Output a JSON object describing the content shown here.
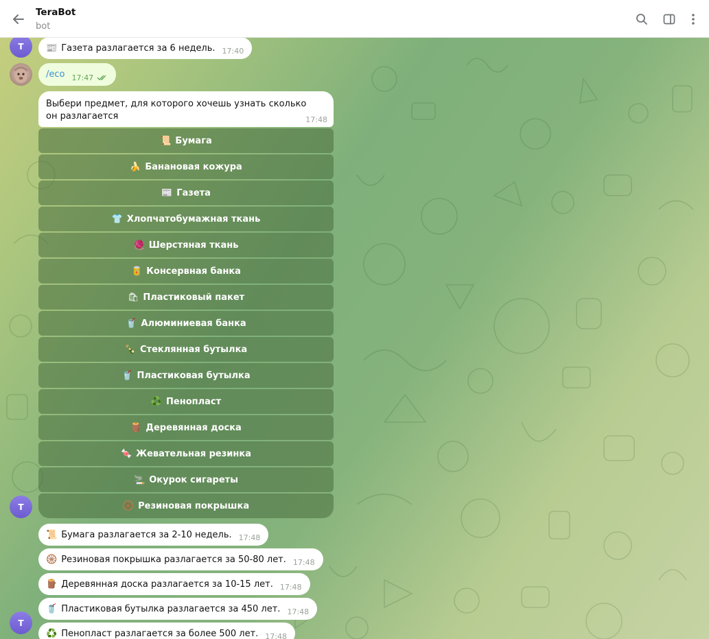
{
  "header": {
    "title": "TeraBot",
    "subtitle": "bot"
  },
  "avatars": {
    "bot_letter": "T"
  },
  "messages": {
    "newspaper": {
      "emoji": "📰",
      "text": "Газета разлагается за 6 недель.",
      "time": "17:40"
    },
    "user_cmd": {
      "text": "/eco",
      "time": "17:47"
    },
    "prompt": {
      "text": "Выбери предмет, для которого хочешь узнать сколько он разлагается",
      "time": "17:48"
    }
  },
  "keyboard": [
    {
      "emoji": "📜",
      "label": "Бумага"
    },
    {
      "emoji": "🍌",
      "label": "Банановая кожура"
    },
    {
      "emoji": "📰",
      "label": "Газета"
    },
    {
      "emoji": "👕",
      "label": "Хлопчатобумажная ткань"
    },
    {
      "emoji": "🧶",
      "label": "Шерстяная ткань"
    },
    {
      "emoji": "🥫",
      "label": "Консервная банка"
    },
    {
      "emoji": "🛍",
      "label": "Пластиковый пакет"
    },
    {
      "emoji": "🥤",
      "label": "Алюминиевая банка"
    },
    {
      "emoji": "🍾",
      "label": "Стеклянная бутылка"
    },
    {
      "emoji": "🥤",
      "label": "Пластиковая бутылка"
    },
    {
      "emoji": "♻️",
      "label": "Пенопласт"
    },
    {
      "emoji": "🪵",
      "label": "Деревянная доска"
    },
    {
      "emoji": "🍬",
      "label": "Жевательная резинка"
    },
    {
      "emoji": "🚬",
      "label": "Окурок сигареты"
    },
    {
      "emoji": "🛞",
      "label": "Резиновая покрышка"
    }
  ],
  "replies": [
    {
      "emoji": "📜",
      "text": "Бумага разлагается за 2-10 недель.",
      "time": "17:48"
    },
    {
      "emoji": "🛞",
      "text": "Резиновая покрышка разлагается за 50-80 лет.",
      "time": "17:48"
    },
    {
      "emoji": "🪵",
      "text": "Деревянная доска разлагается за 10-15 лет.",
      "time": "17:48"
    },
    {
      "emoji": "🥤",
      "text": "Пластиковая бутылка разлагается за 450 лет.",
      "time": "17:48"
    },
    {
      "emoji": "♻️",
      "text": "Пенопласт разлагается за более 500 лет.",
      "time": "17:48"
    }
  ]
}
